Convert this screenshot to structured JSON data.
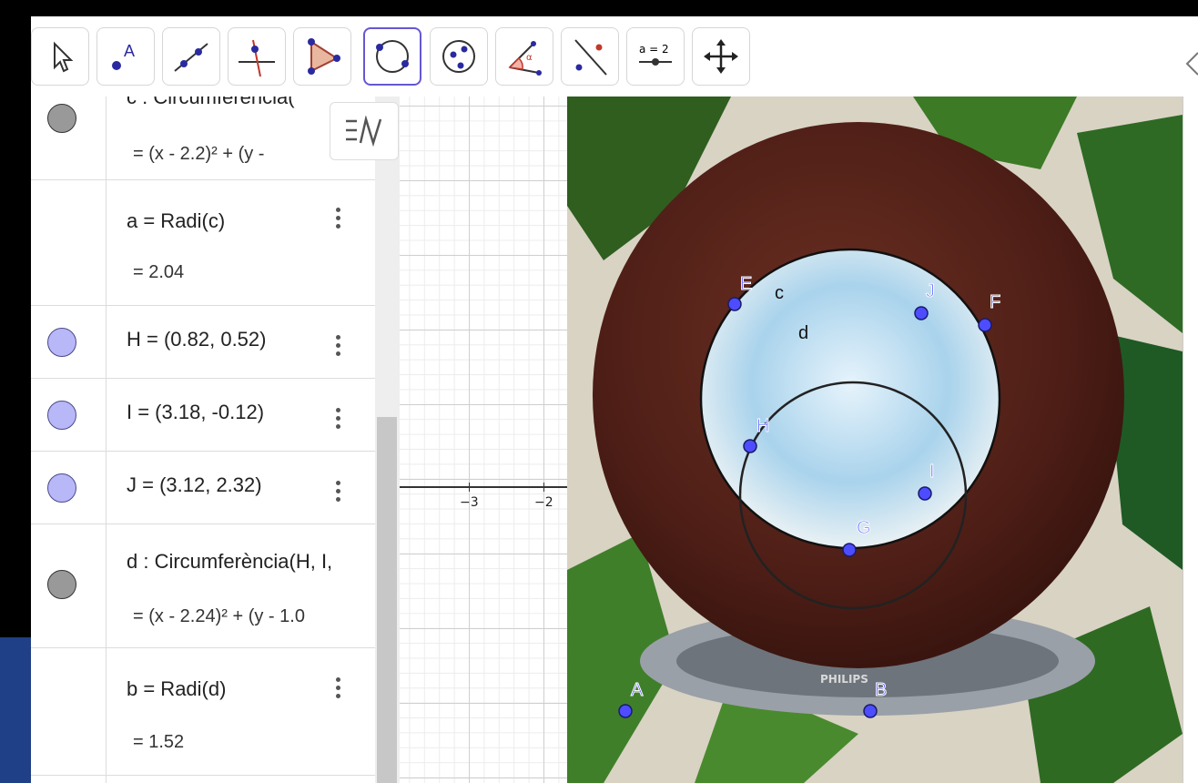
{
  "toolbar": {
    "tools": [
      {
        "name": "move-tool",
        "label": ""
      },
      {
        "name": "point-tool",
        "label": "A"
      },
      {
        "name": "line-tool",
        "label": ""
      },
      {
        "name": "perpendicular-tool",
        "label": ""
      },
      {
        "name": "polygon-tool",
        "label": ""
      },
      {
        "name": "circle-tool",
        "label": ""
      },
      {
        "name": "circle-three-points-tool",
        "label": ""
      },
      {
        "name": "angle-tool",
        "label": "α"
      },
      {
        "name": "reflect-tool",
        "label": ""
      },
      {
        "name": "slider-tool",
        "label": "a = 2"
      },
      {
        "name": "move-graphics-tool",
        "label": ""
      }
    ],
    "selected": "circle-tool"
  },
  "algebra": {
    "rows": [
      {
        "def": "c : Circumferència(",
        "value": "=  (x - 2.2)² + (y -"
      },
      {
        "def": "a  =  Radi(c)",
        "value": "=  2.04"
      },
      {
        "def": "H = (0.82, 0.52)"
      },
      {
        "def": "I = (3.18, -0.12)"
      },
      {
        "def": "J = (3.12, 2.32)"
      },
      {
        "def": "d : Circumferència(H, I,",
        "value": "=  (x - 2.24)² + (y - 1.0"
      },
      {
        "def": "b  =  Radi(d)",
        "value": "=  1.52"
      }
    ]
  },
  "graphics": {
    "x_tick_labels": [
      "−3",
      "−2"
    ],
    "points": [
      "E",
      "J",
      "F",
      "H",
      "I",
      "G",
      "A",
      "B"
    ],
    "circle_labels": [
      "c",
      "d"
    ],
    "photo_text": "PHILIPS"
  },
  "colors": {
    "point_fill": "#4d4dff",
    "bowl_brown": "#4f1f17",
    "selected_tool_border": "#6557d2"
  }
}
